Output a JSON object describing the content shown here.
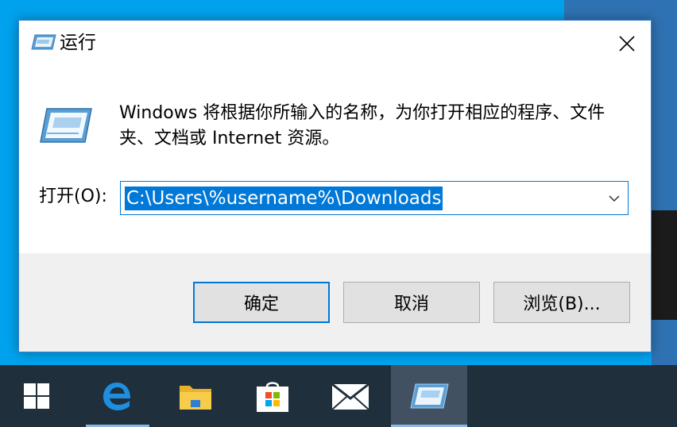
{
  "dialog": {
    "title": "运行",
    "icon": "run-icon",
    "description": "Windows 将根据你所输入的名称，为你打开相应的程序、文件夹、文档或 Internet 资源。",
    "open_label": "打开(O):",
    "open_value": "C:\\Users\\%username%\\Downloads",
    "buttons": {
      "ok": "确定",
      "cancel": "取消",
      "browse": "浏览(B)..."
    },
    "accent": "#0078d7"
  },
  "taskbar": {
    "items": [
      "start-icon",
      "edge-icon",
      "file-explorer-icon",
      "store-icon",
      "mail-icon",
      "run-icon"
    ]
  }
}
